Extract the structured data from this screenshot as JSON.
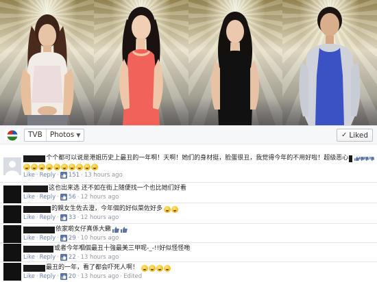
{
  "toolbar": {
    "source": "TVB",
    "album": "Photos",
    "liked_label": "Liked"
  },
  "colors": {
    "link": "#6d84b4",
    "dress_coral": "#f0625a",
    "dress_blue": "#3b52c4"
  },
  "comments": [
    {
      "text": "个个都可以说是港姐历史上最丑的一年啊！天啊！她们的身材挺，脸蛋很丑，我觉得今年的不用好啦！超级恶心",
      "like_count": "151",
      "time": "13 hours ago"
    },
    {
      "text": "这也出来选 还不如在街上随便找一个也比她们好看",
      "like_count": "56",
      "time": "12 hours ago"
    },
    {
      "text": "的親女生佐去澄，今年個的好似菜佐好多",
      "like_count": "33",
      "time": "12 hours ago"
    },
    {
      "text": "依家啲女仔真係大饊",
      "like_count": "29",
      "time": "10 hours ago"
    },
    {
      "text": "或者今年嗰個最丑十強最美三甲呢-_-!!好似怪怪咃",
      "like_count": "22",
      "time": "13 hours ago"
    },
    {
      "text": "最丑的一年，看了都会吓死人啊！",
      "like_count": "20",
      "time": "13 hours ago",
      "edited": "Edited"
    }
  ],
  "actions": {
    "like": "Like",
    "reply": "Reply",
    "dot": "·"
  }
}
